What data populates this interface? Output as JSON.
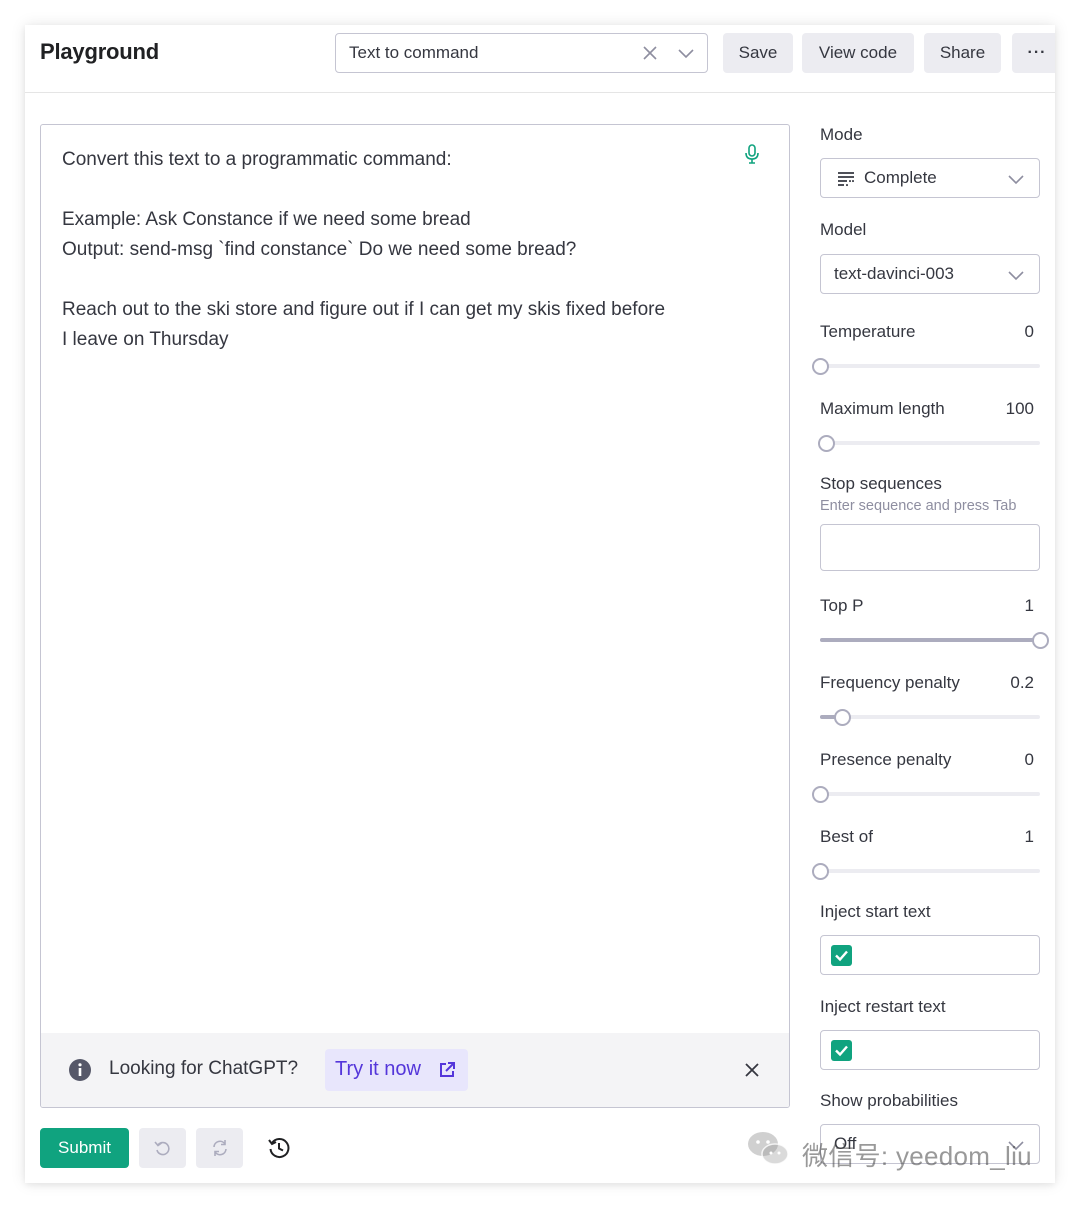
{
  "header": {
    "title": "Playground",
    "preset": {
      "value": "Text to command"
    },
    "buttons": {
      "save": "Save",
      "view_code": "View code",
      "share": "Share",
      "more": "···"
    }
  },
  "editor": {
    "text": "Convert this text to a programmatic command:\n\nExample: Ask Constance if we need some bread\nOutput: send-msg `find constance` Do we need some bread?\n\nReach out to the ski store and figure out if I can get my skis fixed before\nI leave on Thursday"
  },
  "banner": {
    "text": "Looking for ChatGPT?",
    "link": "Try it now"
  },
  "footer": {
    "submit": "Submit"
  },
  "settings": {
    "mode": {
      "label": "Mode",
      "value": "Complete"
    },
    "model": {
      "label": "Model",
      "value": "text-davinci-003"
    },
    "temperature": {
      "label": "Temperature",
      "value": "0",
      "fraction": 0
    },
    "max_length": {
      "label": "Maximum length",
      "value": "100",
      "fraction": 0.025
    },
    "stop_sequences": {
      "label": "Stop sequences",
      "hint": "Enter sequence and press Tab"
    },
    "top_p": {
      "label": "Top P",
      "value": "1",
      "fraction": 1
    },
    "frequency_penalty": {
      "label": "Frequency penalty",
      "value": "0.2",
      "fraction": 0.1
    },
    "presence_penalty": {
      "label": "Presence penalty",
      "value": "0",
      "fraction": 0
    },
    "best_of": {
      "label": "Best of",
      "value": "1",
      "fraction": 0
    },
    "inject_start": {
      "label": "Inject start text",
      "checked": true
    },
    "inject_restart": {
      "label": "Inject restart text",
      "checked": true
    },
    "show_probabilities": {
      "label": "Show probabilities",
      "value": "Off"
    }
  },
  "watermark": {
    "text": "微信号: yeedom_liu"
  },
  "colors": {
    "accent": "#10a37f",
    "link": "#5436da",
    "link_bg": "#e8e6fc"
  }
}
